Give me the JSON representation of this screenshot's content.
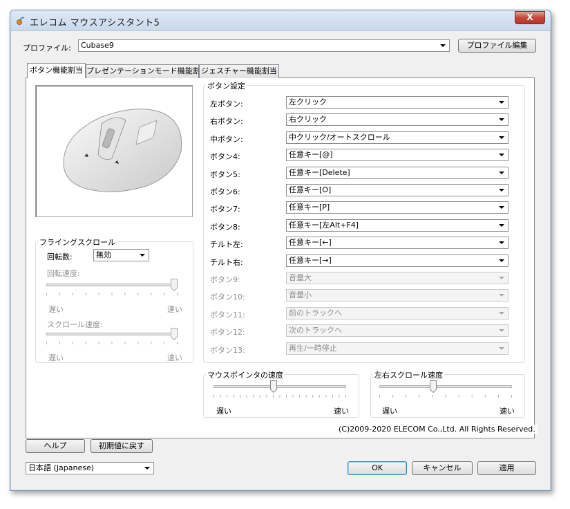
{
  "window": {
    "title": "エレコム マウスアシスタント5",
    "close_label": "X"
  },
  "profile": {
    "label": "プロファイル:",
    "value": "Cubase9",
    "edit_label": "プロファイル編集"
  },
  "tabs": [
    {
      "label": "ボタン機能割当"
    },
    {
      "label": "プレゼンテーションモード機能割当"
    },
    {
      "label": "ジェスチャー機能割当"
    }
  ],
  "button_settings": {
    "title": "ボタン設定",
    "rows": [
      {
        "label": "左ボタン:",
        "value": "左クリック",
        "enabled": true
      },
      {
        "label": "右ボタン:",
        "value": "右クリック",
        "enabled": true
      },
      {
        "label": "中ボタン:",
        "value": "中クリック/オートスクロール",
        "enabled": true
      },
      {
        "label": "ボタン4:",
        "value": "任意キー[@]",
        "enabled": true
      },
      {
        "label": "ボタン5:",
        "value": "任意キー[Delete]",
        "enabled": true
      },
      {
        "label": "ボタン6:",
        "value": "任意キー[O]",
        "enabled": true
      },
      {
        "label": "ボタン7:",
        "value": "任意キー[P]",
        "enabled": true
      },
      {
        "label": "ボタン8:",
        "value": "任意キー[左Alt+F4]",
        "enabled": true
      },
      {
        "label": "チルト左:",
        "value": "任意キー[←]",
        "enabled": true
      },
      {
        "label": "チルト右:",
        "value": "任意キー[→]",
        "enabled": true
      },
      {
        "label": "ボタン9:",
        "value": "音量大",
        "enabled": false
      },
      {
        "label": "ボタン10:",
        "value": "音量小",
        "enabled": false
      },
      {
        "label": "ボタン11:",
        "value": "前のトラックへ",
        "enabled": false
      },
      {
        "label": "ボタン12:",
        "value": "次のトラックへ",
        "enabled": false
      },
      {
        "label": "ボタン13:",
        "value": "再生/一時停止",
        "enabled": false
      }
    ]
  },
  "flying_scroll": {
    "title": "フライングスクロール",
    "rotation_label": "回転数:",
    "rotation_value": "無効",
    "rotation_speed_label": "回転速度:",
    "rotation_speed_level": 1.0,
    "scroll_speed_label": "スクロール速度:",
    "scroll_speed_level": 1.0,
    "slow": "遅い",
    "fast": "速い"
  },
  "pointer_speed": {
    "title": "マウスポインタの速度",
    "level": 0.45,
    "slow": "遅い",
    "fast": "速い"
  },
  "hscroll_speed": {
    "title": "左右スクロール速度",
    "level": 0.4,
    "slow": "遅い",
    "fast": "速い"
  },
  "copyright": "(C)2009-2020 ELECOM Co.,Ltd. All Rights Reserved.",
  "footer": {
    "help_label": "ヘルプ",
    "reset_label": "初期値に戻す",
    "language": "日本語 (Japanese)",
    "ok_label": "OK",
    "cancel_label": "キャンセル",
    "apply_label": "適用"
  },
  "colors": {
    "titlebar": "#c9d9ec",
    "close": "#c8463a",
    "panel_bg": "#ffffff",
    "window_bg": "#f0f0f0"
  }
}
